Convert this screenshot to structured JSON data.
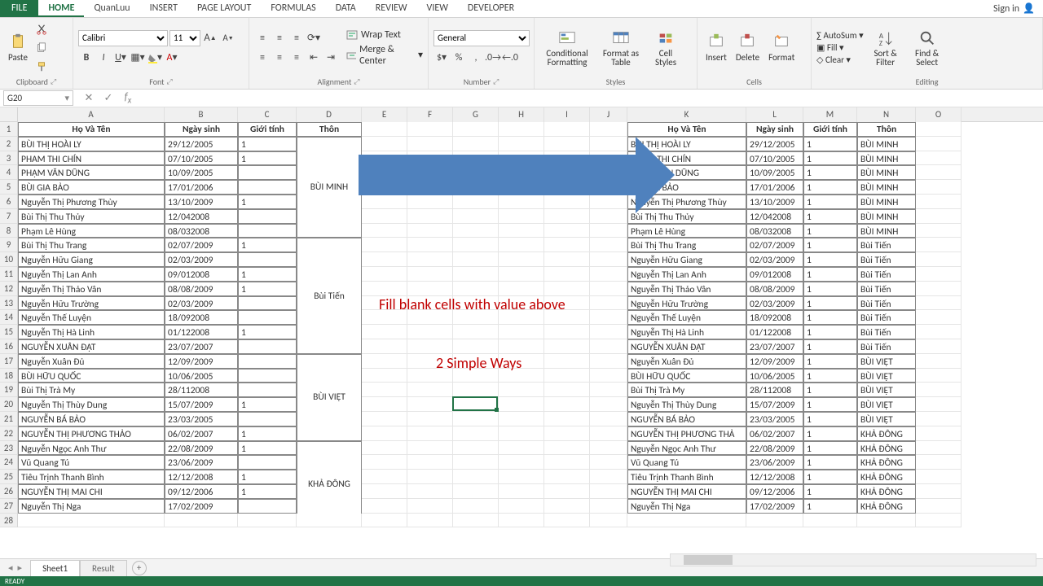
{
  "tabs": {
    "file": "FILE",
    "home": "HOME",
    "custom": "QuanLuu",
    "insert": "INSERT",
    "pageLayout": "PAGE LAYOUT",
    "formulas": "FORMULAS",
    "data": "DATA",
    "review": "REVIEW",
    "view": "VIEW",
    "developer": "DEVELOPER"
  },
  "signin": "Sign in",
  "ribbon": {
    "clipboard": {
      "label": "Clipboard",
      "paste": "Paste"
    },
    "font": {
      "label": "Font",
      "name": "Calibri",
      "size": "11"
    },
    "alignment": {
      "label": "Alignment",
      "wrap": "Wrap Text",
      "merge": "Merge & Center"
    },
    "number": {
      "label": "Number",
      "format": "General"
    },
    "styles": {
      "label": "Styles",
      "cond": "Conditional Formatting",
      "fat": "Format as Table",
      "cell": "Cell Styles"
    },
    "cells": {
      "label": "Cells",
      "insert": "Insert",
      "delete": "Delete",
      "format": "Format"
    },
    "editing": {
      "label": "Editing",
      "autosum": "AutoSum",
      "fill": "Fill",
      "clear": "Clear",
      "sort": "Sort & Filter",
      "find": "Find & Select"
    }
  },
  "namebox": "G20",
  "annotations": {
    "line1": "Fill blank cells with value above",
    "line2": "2 Simple Ways"
  },
  "sheets": {
    "s1": "Sheet1",
    "s2": "Result"
  },
  "status": "READY",
  "colWidths": {
    "A": 180,
    "B": 90,
    "C": 72,
    "D": 80,
    "E": 56,
    "F": 56,
    "G": 56,
    "H": 56,
    "I": 56,
    "J": 46,
    "K": 146,
    "L": 70,
    "M": 66,
    "N": 72,
    "O": 56
  },
  "headers": {
    "name": "Họ Và Tên",
    "dob": "Ngày sinh",
    "gender": "Giới tính",
    "village": "Thôn"
  },
  "leftVillages": [
    {
      "label": "BÙI MINH",
      "rows": 7
    },
    {
      "label": "Bùi Tiến",
      "rows": 8
    },
    {
      "label": "BÙI VIỆT",
      "rows": 6
    },
    {
      "label": "KHẢ ĐÔNG",
      "rows": 6
    }
  ],
  "rows": [
    {
      "a": "BÙI THỊ HOÀI  LY",
      "b": "29/12/2005",
      "c": "1",
      "k": "BÙI THỊ HOÀI  LY",
      "l": "29/12/2005",
      "m": "1",
      "n": "BÙI MINH"
    },
    {
      "a": "PHAM THI  CHÍN",
      "b": "07/10/2005",
      "c": "1",
      "k": "PHAM THI  CHÍN",
      "l": "07/10/2005",
      "m": "1",
      "n": "BÙI MINH"
    },
    {
      "a": "PHẠM VĂN DŨNG",
      "b": "10/09/2005",
      "c": "",
      "k": "PHẠM VĂN DŨNG",
      "l": "10/09/2005",
      "m": "1",
      "n": "BÙI MINH"
    },
    {
      "a": "BÙI GIA BẢO",
      "b": "17/01/2006",
      "c": "",
      "k": "BÙI GIA BẢO",
      "l": "17/01/2006",
      "m": "1",
      "n": "BÙI MINH"
    },
    {
      "a": "Nguyễn Thị Phương Thùy",
      "b": "13/10/2009",
      "c": "1",
      "k": "Nguyễn Thị Phương Thùy",
      "l": "13/10/2009",
      "m": "1",
      "n": "BÙI MINH"
    },
    {
      "a": "Bùi Thị Thu Thủy",
      "b": "12/042008",
      "c": "",
      "k": "Bùi Thị Thu Thủy",
      "l": "12/042008",
      "m": "1",
      "n": "BÙI MINH"
    },
    {
      "a": "Phạm Lê Hùng",
      "b": "08/032008",
      "c": "",
      "k": "Phạm Lê Hùng",
      "l": "08/032008",
      "m": "1",
      "n": "BÙI MINH"
    },
    {
      "a": "Bùi Thị Thu Trang",
      "b": "02/07/2009",
      "c": "1",
      "k": "Bùi Thị Thu Trang",
      "l": "02/07/2009",
      "m": "1",
      "n": "Bùi Tiến"
    },
    {
      "a": "Nguyễn Hữu Giang",
      "b": "02/03/2009",
      "c": "",
      "k": "Nguyễn Hữu Giang",
      "l": "02/03/2009",
      "m": "1",
      "n": "Bùi Tiến"
    },
    {
      "a": "Nguyễn Thị Lan Anh",
      "b": "09/012008",
      "c": "1",
      "k": "Nguyễn Thị Lan Anh",
      "l": "09/012008",
      "m": "1",
      "n": "Bùi Tiến"
    },
    {
      "a": "Nguyễn Thị Thảo Vân",
      "b": "08/08/2009",
      "c": "1",
      "k": "Nguyễn Thị Thảo Vân",
      "l": "08/08/2009",
      "m": "1",
      "n": "Bùi Tiến"
    },
    {
      "a": "Nguyễn Hữu Trường",
      "b": "02/03/2009",
      "c": "",
      "k": "Nguyễn Hữu Trường",
      "l": "02/03/2009",
      "m": "1",
      "n": "Bùi Tiến"
    },
    {
      "a": "Nguyễn Thế Luyện",
      "b": "18/092008",
      "c": "",
      "k": "Nguyễn Thế Luyện",
      "l": "18/092008",
      "m": "1",
      "n": "Bùi Tiến"
    },
    {
      "a": "Nguyễn Thị Hà Linh",
      "b": "01/122008",
      "c": "1",
      "k": "Nguyễn Thị Hà Linh",
      "l": "01/122008",
      "m": "1",
      "n": "Bùi Tiến"
    },
    {
      "a": "NGUYỄN XUÂN  ĐẠT",
      "b": "23/07/2007",
      "c": "",
      "k": "NGUYỄN XUÂN  ĐẠT",
      "l": "23/07/2007",
      "m": "1",
      "n": "Bùi Tiến"
    },
    {
      "a": "Nguyễn Xuân Đủ",
      "b": "12/09/2009",
      "c": "",
      "k": "Nguyễn Xuân Đủ",
      "l": "12/09/2009",
      "m": "1",
      "n": "BÙI VIỆT"
    },
    {
      "a": "BÙI HỮU QUỐC",
      "b": "10/06/2005",
      "c": "",
      "k": "BÙI HỮU QUỐC",
      "l": "10/06/2005",
      "m": "1",
      "n": "BÙI VIỆT"
    },
    {
      "a": "Bùi Thị Trà My",
      "b": "28/112008",
      "c": "",
      "k": "Bùi Thị Trà My",
      "l": "28/112008",
      "m": "1",
      "n": "BÙI VIỆT"
    },
    {
      "a": "Nguyễn Thị Thùy Dung",
      "b": "15/07/2009",
      "c": "1",
      "k": "Nguyễn Thị Thùy Dung",
      "l": "15/07/2009",
      "m": "1",
      "n": "BÙI VIỆT"
    },
    {
      "a": "NGUYỄN BÁ BẢO",
      "b": "23/03/2005",
      "c": "",
      "k": "NGUYỄN BÁ BẢO",
      "l": "23/03/2005",
      "m": "1",
      "n": "BÙI VIỆT"
    },
    {
      "a": "NGUYỄN THỊ PHƯƠNG  THẢO",
      "b": "06/02/2007",
      "c": "1",
      "k": "NGUYỄN THỊ PHƯƠNG  THẢ",
      "l": "06/02/2007",
      "m": "1",
      "n": "KHẢ ĐÔNG"
    },
    {
      "a": "Nguyễn Ngọc Anh Thư",
      "b": "22/08/2009",
      "c": "1",
      "k": "Nguyễn Ngọc Anh Thư",
      "l": "22/08/2009",
      "m": "1",
      "n": "KHẢ ĐÔNG"
    },
    {
      "a": "Vũ Quang Tú",
      "b": "23/06/2009",
      "c": "",
      "k": "Vũ Quang Tú",
      "l": "23/06/2009",
      "m": "1",
      "n": "KHẢ ĐÔNG"
    },
    {
      "a": "Tiêu Trịnh Thanh Bình",
      "b": "12/12/2008",
      "c": "1",
      "k": "Tiêu Trịnh Thanh Bình",
      "l": "12/12/2008",
      "m": "1",
      "n": "KHẢ ĐÔNG"
    },
    {
      "a": "NGUYỄN THỊ MAI CHI",
      "b": "09/12/2006",
      "c": "1",
      "k": "NGUYỄN THỊ MAI CHI",
      "l": "09/12/2006",
      "m": "1",
      "n": "KHẢ ĐÔNG"
    },
    {
      "a": "Nguyễn Thị Nga",
      "b": "17/02/2009",
      "c": "",
      "k": "Nguyễn Thị Nga",
      "l": "17/02/2009",
      "m": "1",
      "n": "KHẢ ĐÔNG"
    }
  ]
}
